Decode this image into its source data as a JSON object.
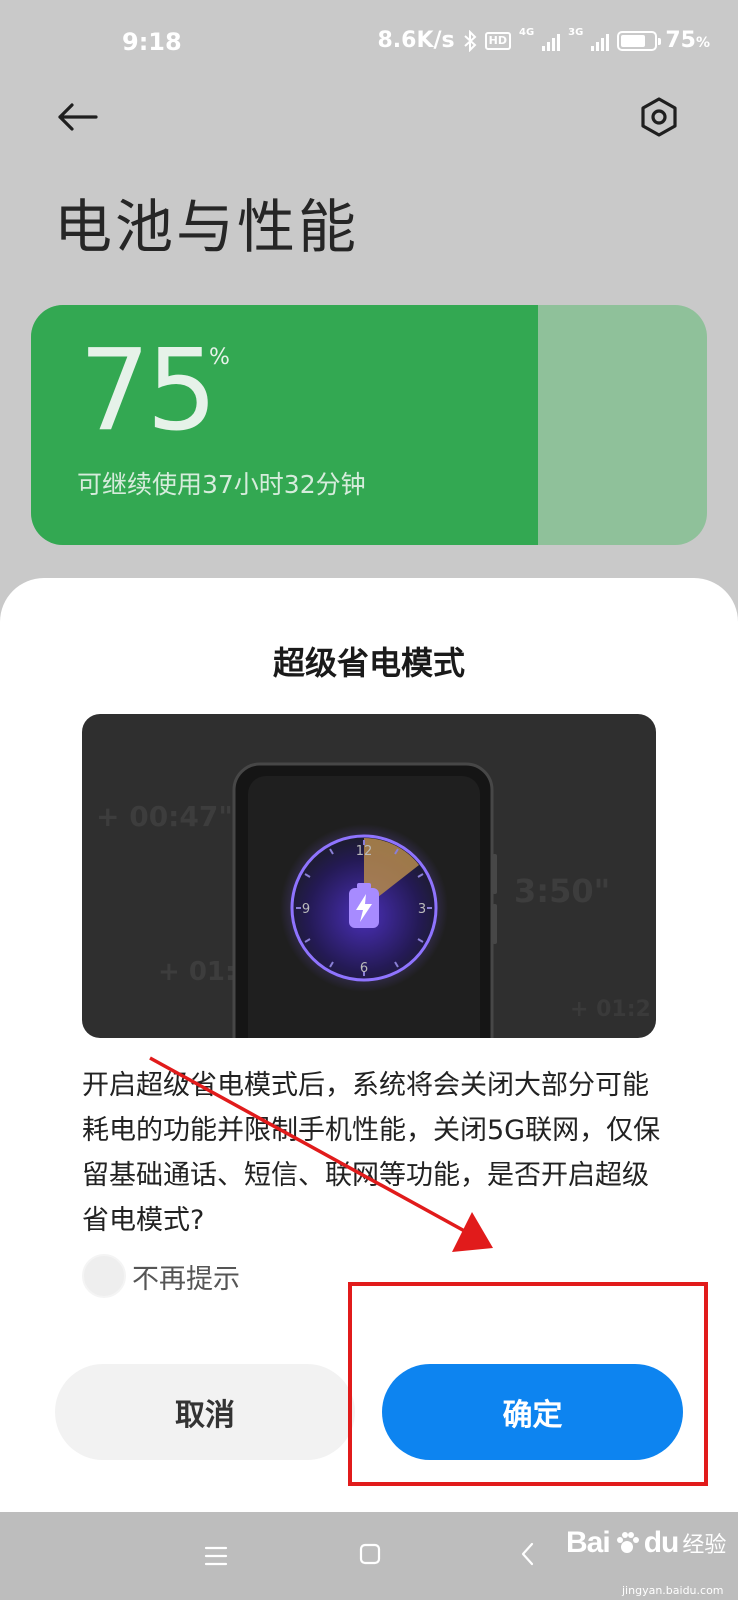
{
  "status_bar": {
    "time": "9:18",
    "network_speed": "8.6K/s",
    "hd_badge": "HD",
    "sim1_tag": "4G",
    "sim2_tag": "3G",
    "battery_text": "75",
    "battery_unit": "%",
    "battery_level": 0.75
  },
  "header": {
    "title": "电池与性能",
    "back_icon": "arrow-left-icon",
    "settings_icon": "hexagon-gear-icon"
  },
  "battery_card": {
    "percent": "75",
    "percent_sign": "%",
    "remaining": "可继续使用37小时32分钟",
    "level": 0.75,
    "fill_color": "#33a852",
    "empty_color": "#8fc19a"
  },
  "dialog": {
    "title": "超级省电模式",
    "illustration_texts": {
      "lap1": "+ 00:47\"",
      "lap2": "3:50\"",
      "lap3": "+ 01:2",
      "lap4": "+ 01:2"
    },
    "clock_numbers": [
      "12",
      "3",
      "6",
      "9"
    ],
    "body": "开启超级省电模式后，系统将会关闭大部分可能耗电的功能并限制手机性能，关闭5G联网，仅保留基础通话、短信、联网等功能，是否开启超级省电模式?",
    "dont_remind": "不再提示",
    "cancel": "取消",
    "confirm": "确定",
    "accent_color": "#0d84f0"
  },
  "nav_bar": {
    "menu_icon": "menu-icon",
    "home_icon": "home-square-icon",
    "back_icon": "chevron-left-icon"
  },
  "watermark": {
    "logo": "Bai",
    "logo_suffix": "du",
    "jingyan": "经验",
    "url": "jingyan.baidu.com"
  }
}
